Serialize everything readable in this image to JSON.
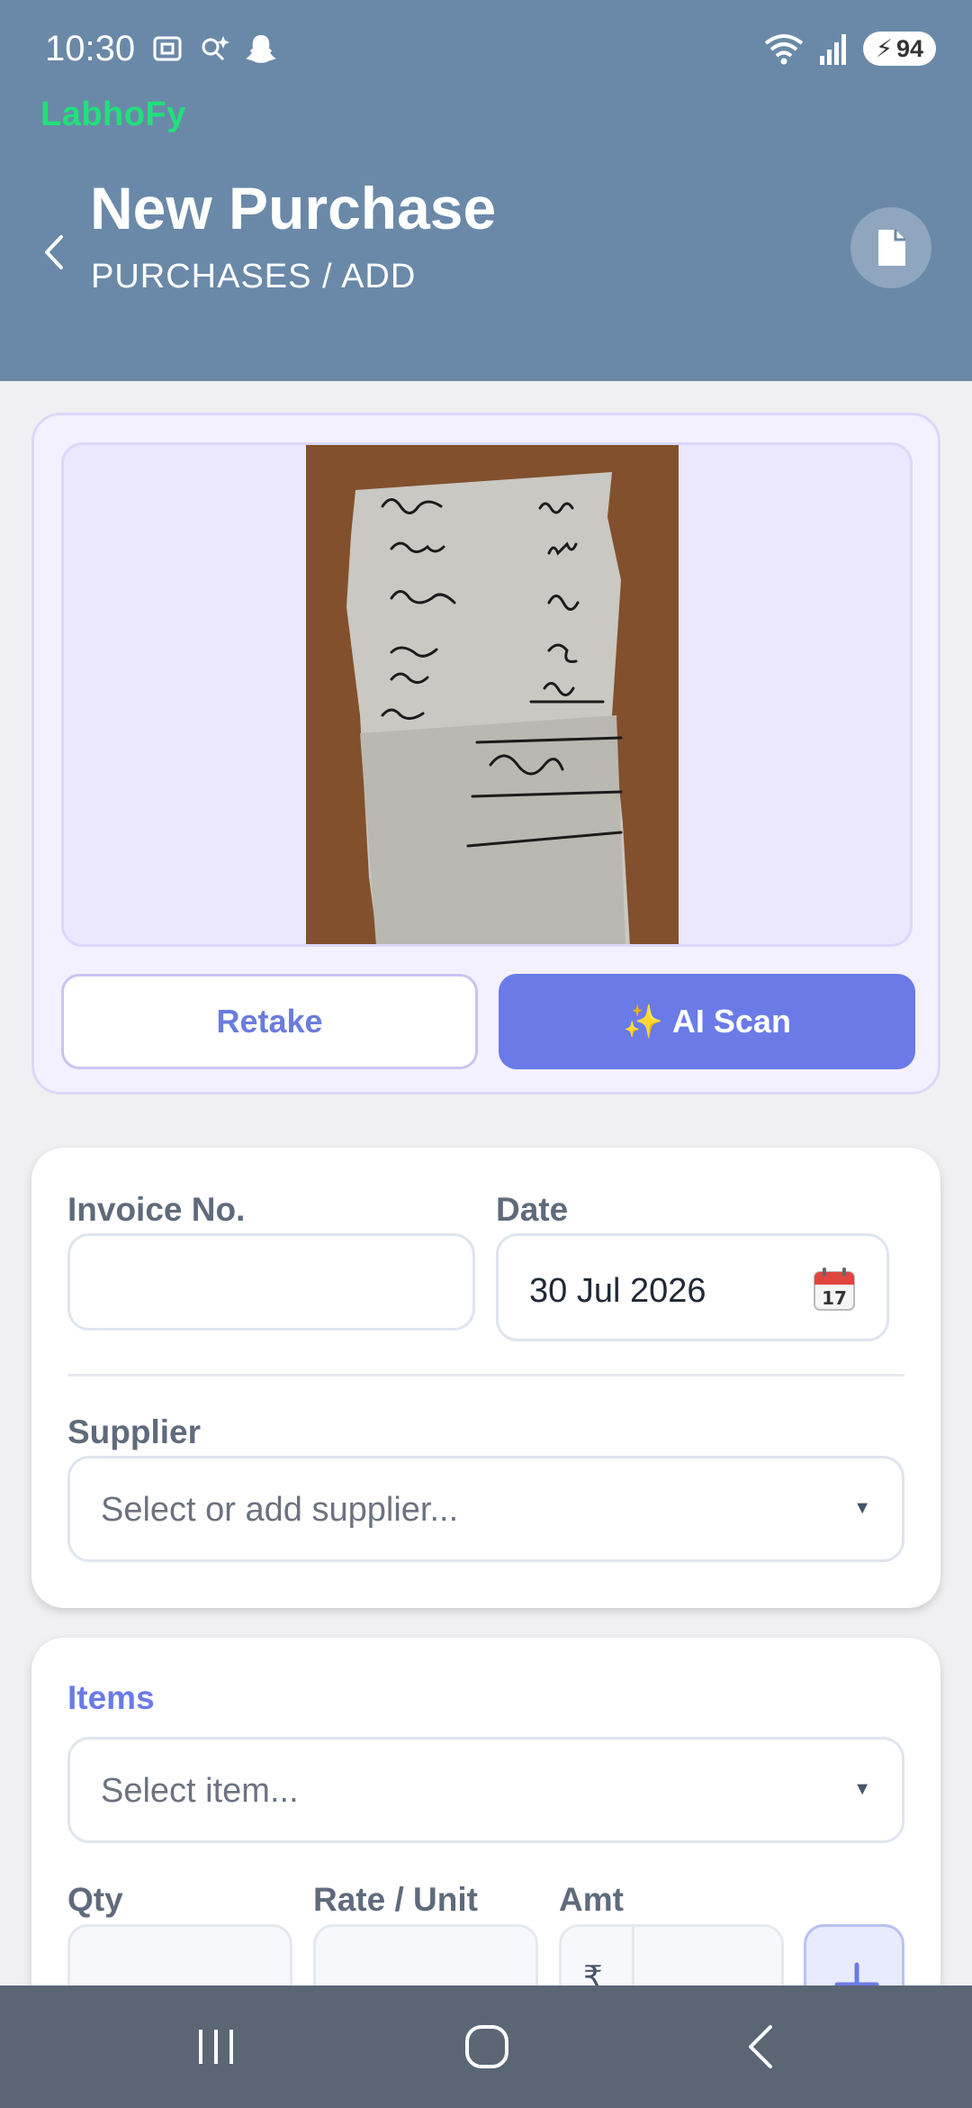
{
  "status_bar": {
    "time": "10:30",
    "battery": "94"
  },
  "app": {
    "brand": "LabhoFy"
  },
  "header": {
    "title": "New Purchase",
    "breadcrumb": "PURCHASES / ADD"
  },
  "scan": {
    "retake_label": "Retake",
    "ai_scan_label": "AI Scan",
    "ai_scan_emoji": "✨"
  },
  "form": {
    "invoice_label": "Invoice No.",
    "invoice_value": "",
    "date_label": "Date",
    "date_value": "30 Jul 2026",
    "supplier_label": "Supplier",
    "supplier_placeholder": "Select or add supplier..."
  },
  "items": {
    "title": "Items",
    "item_placeholder": "Select item...",
    "qty_label": "Qty",
    "rate_label": "Rate / Unit",
    "amt_label": "Amt",
    "currency_symbol": "₹"
  },
  "colors": {
    "header_bg": "#6a89a8",
    "brand": "#22e07a",
    "accent": "#6a7be8"
  },
  "icons": {
    "back": "chevron-left-icon",
    "document": "document-icon",
    "calendar": "calendar-icon",
    "add": "plus-icon"
  }
}
